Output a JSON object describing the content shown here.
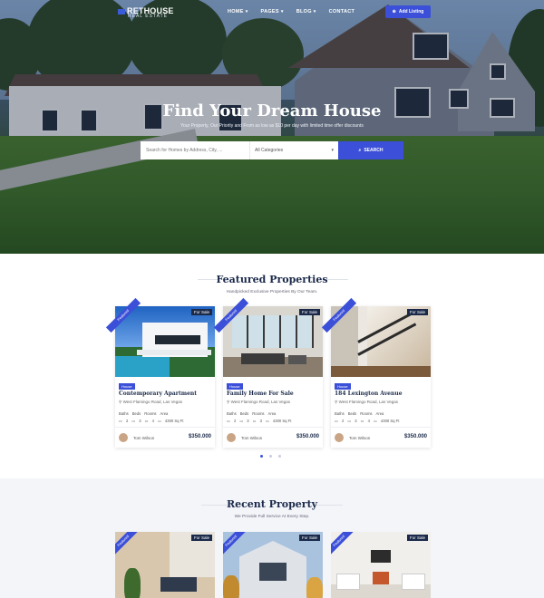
{
  "nav": {
    "logo": "RETHOUSE",
    "logo_sub": "REAL ESTATE",
    "menu": [
      "HOME",
      "PAGES",
      "BLOG",
      "CONTACT"
    ],
    "add_listing": "Add Listing"
  },
  "hero": {
    "title": "Find Your Dream House",
    "subtitle": "Your Property, Our Priority and From as low as $10 per day with limited time offer discounts",
    "search_placeholder": "Search for Homes by Address, City, ...",
    "category": "All Categories",
    "search_button": "SEARCH"
  },
  "featured": {
    "title": "Featured Properties",
    "subtitle": "Handpicked Exclusive Properties By Our Team.",
    "cards": [
      {
        "ribbon": "Featured",
        "badge": "For Sale",
        "type": "House",
        "title": "Contemporary Apartment",
        "address": "West Flamingo Road, Las Vegas",
        "labels": [
          "Baths",
          "Beds",
          "Rooms",
          "Area"
        ],
        "values": [
          "2",
          "3",
          "4",
          "4300 Sq Ft"
        ],
        "agent": "Tom Wilson",
        "price": "$350.000"
      },
      {
        "ribbon": "Featured",
        "badge": "For Sale",
        "type": "House",
        "title": "Family Home For Sale",
        "address": "West Flamingo Road, Las Vegas",
        "labels": [
          "Baths",
          "Beds",
          "Rooms",
          "Area"
        ],
        "values": [
          "2",
          "3",
          "3",
          "4300 Sq Ft"
        ],
        "agent": "Tom Wilson",
        "price": "$350.000"
      },
      {
        "ribbon": "Featured",
        "badge": "For Sale",
        "type": "House",
        "title": "184 Lexington Avenue",
        "address": "West Flamingo Road, Las Vegas",
        "labels": [
          "Baths",
          "Beds",
          "Rooms",
          "Area"
        ],
        "values": [
          "2",
          "3",
          "4",
          "4300 Sq Ft"
        ],
        "agent": "Tom Wilson",
        "price": "$350.000"
      }
    ]
  },
  "recent": {
    "title": "Recent Property",
    "subtitle": "We Provide Full Service At Every Step.",
    "cards": [
      {
        "ribbon": "Featured",
        "badge": "For Sale"
      },
      {
        "ribbon": "Featured",
        "badge": "For Sale"
      },
      {
        "ribbon": "Featured",
        "badge": "For Sale"
      }
    ]
  },
  "colors": {
    "accent": "#3b4fd8",
    "navy": "#1b2a4a"
  }
}
